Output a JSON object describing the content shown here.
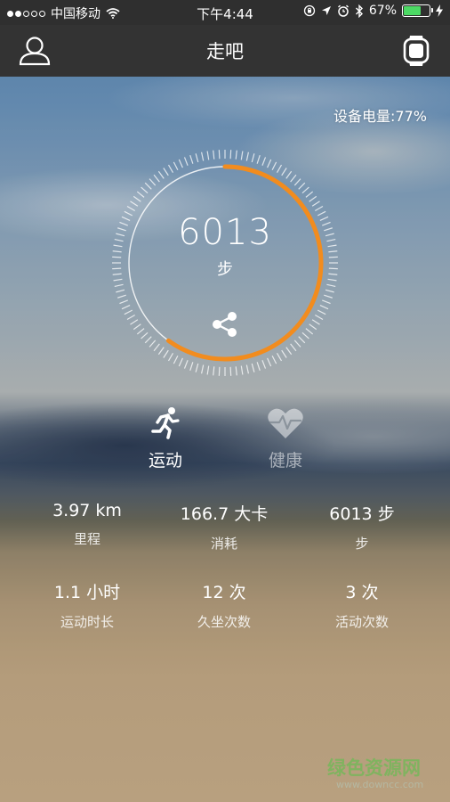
{
  "status_bar": {
    "carrier": "中国移动",
    "time": "下午4:44",
    "battery_percent": "67%",
    "battery_level": 0.67,
    "wifi_icon": "wifi-icon",
    "icons": [
      "rotation-lock-icon",
      "location-arrow-icon",
      "alarm-icon",
      "bluetooth-icon",
      "charging-bolt-icon"
    ]
  },
  "header": {
    "title": "走吧",
    "left_icon": "user-profile-icon",
    "right_icon": "smartwatch-icon"
  },
  "device": {
    "battery_label": "设备电量:77%"
  },
  "ring": {
    "steps": "6013",
    "unit": "步",
    "progress": 0.6,
    "accent_color": "#f28c1e",
    "share_icon": "share-icon"
  },
  "modes": {
    "sport_label": "运动",
    "health_label": "健康"
  },
  "stats": {
    "distance_value": "3.97 km",
    "distance_label": "里程",
    "calories_value": "166.7 大卡",
    "calories_label": "消耗",
    "steps_value": "6013 步",
    "steps_label": "步",
    "duration_value": "1.1 小时",
    "duration_label": "运动时长",
    "sedentary_value": "12 次",
    "sedentary_label": "久坐次数",
    "activity_value": "3 次",
    "activity_label": "活动次数"
  },
  "watermark": {
    "text": "绿色资源网",
    "sub": "www.downcc.com"
  }
}
